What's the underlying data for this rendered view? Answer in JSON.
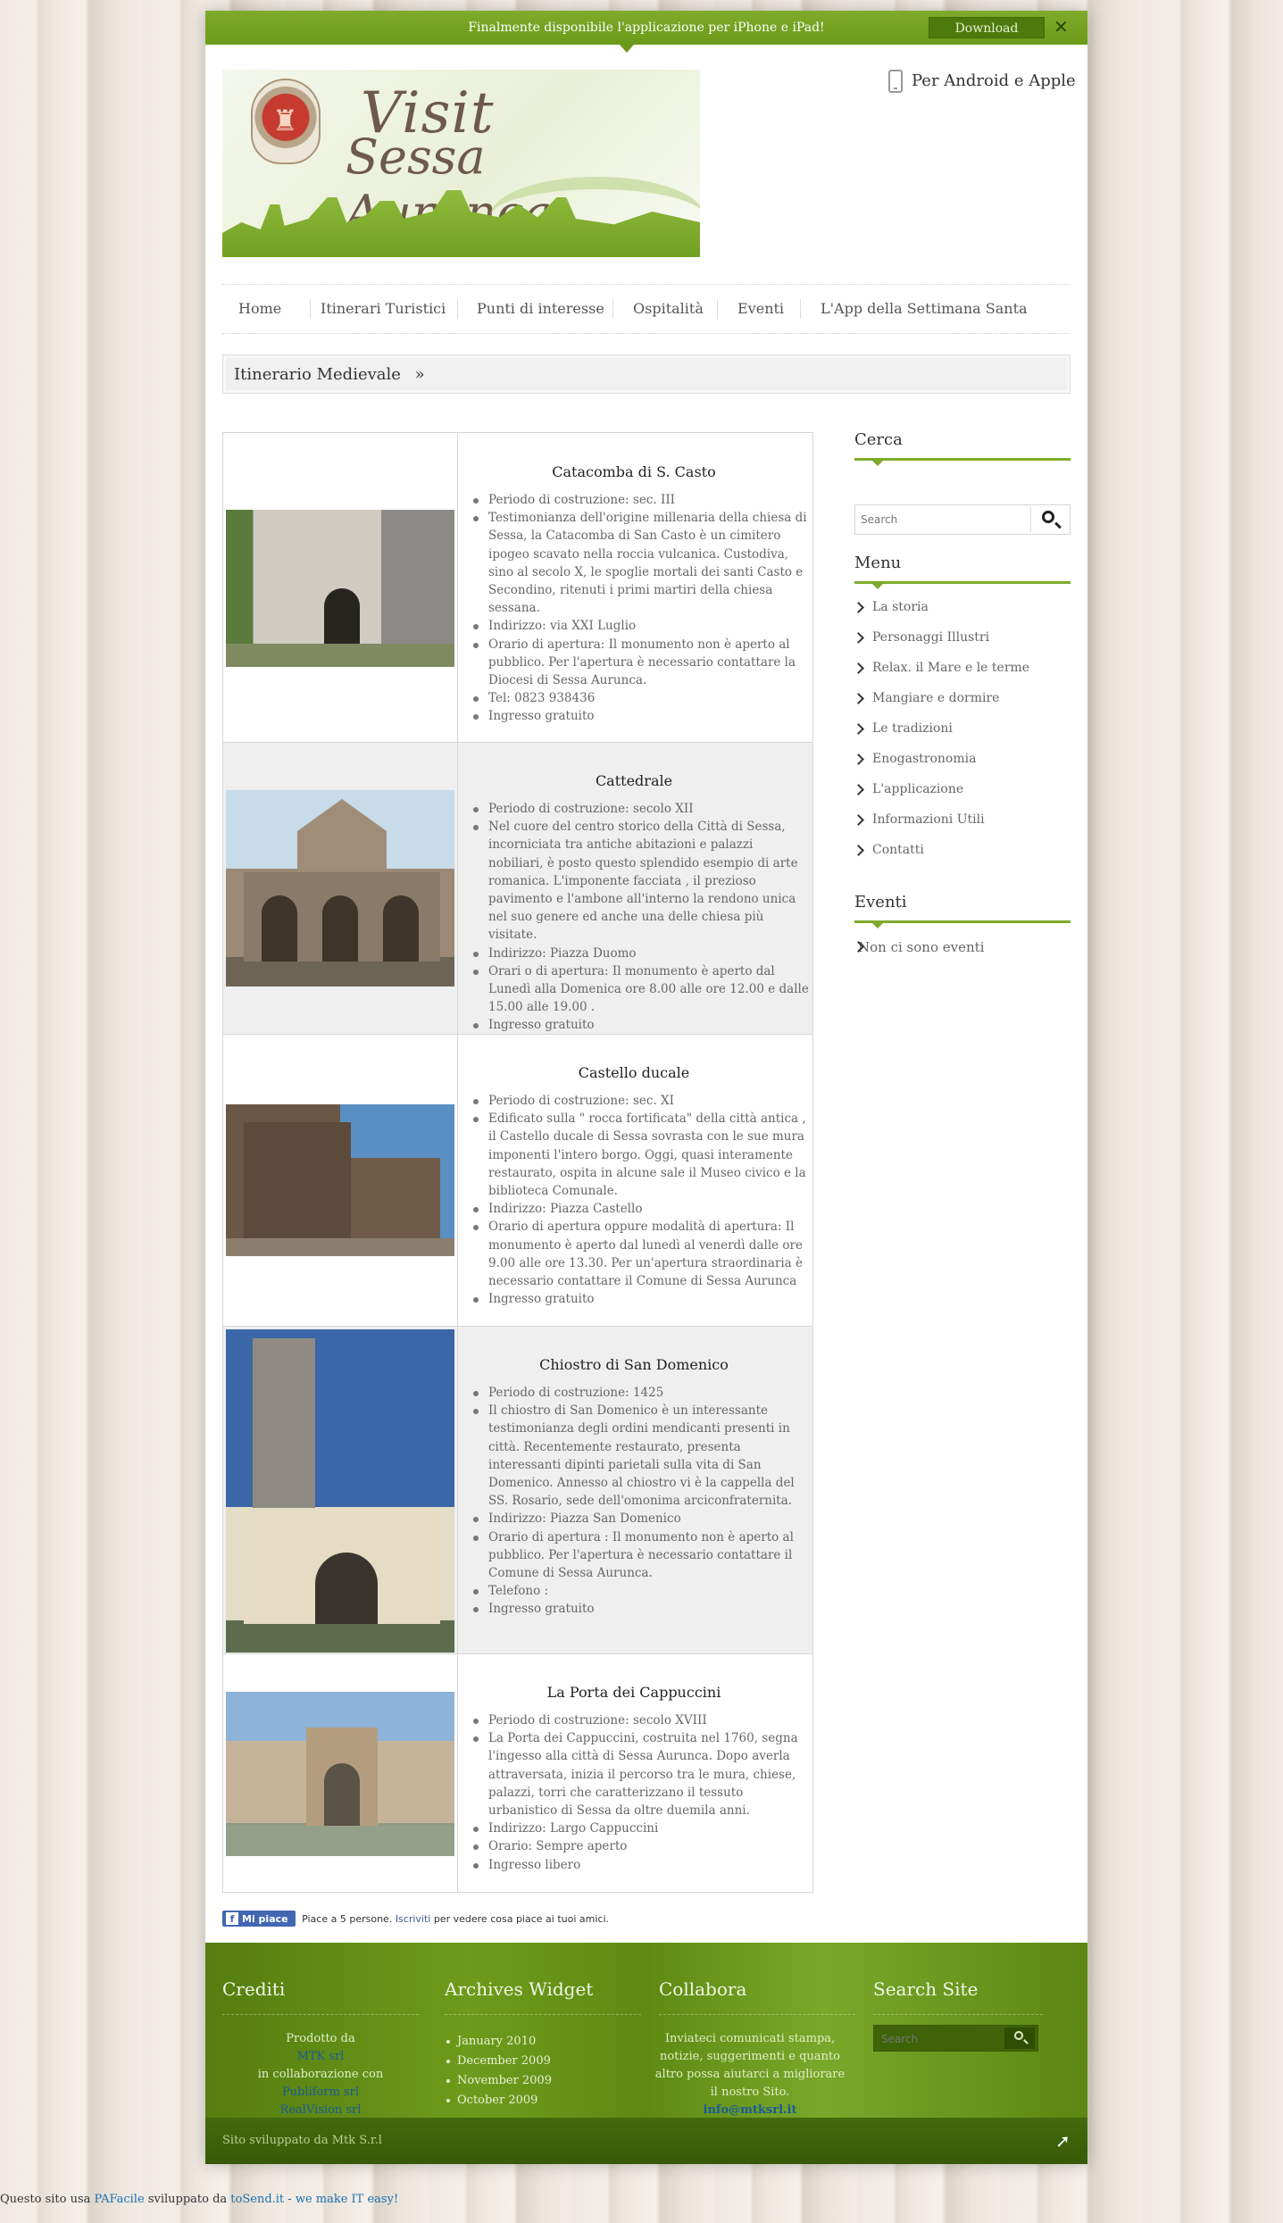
{
  "topbar": {
    "message": "Finalmente disponibile l'applicazione per iPhone e iPad!",
    "download_label": "Download",
    "close_icon": "close-icon",
    "accent_color": "#6a9a19"
  },
  "header": {
    "logo_line1": "Visit",
    "logo_line2": "Sessa Aurunca",
    "apps_label": "Per Android e Apple"
  },
  "nav": {
    "items": [
      "Home",
      "Itinerari Turistici",
      "Punti di interesse",
      "Ospitalità",
      "Eventi",
      "L'App della Settimana Santa"
    ]
  },
  "breadcrumb": {
    "label": "Itinerario Medievale",
    "separator": "»"
  },
  "places": [
    {
      "title": "Catacomba di S. Casto",
      "items": [
        "Periodo di costruzione: sec. III",
        "Testimonianza dell'origine millenaria della chiesa di Sessa, la Catacomba di San Casto è un cimitero ipogeo scavato nella roccia vulcanica. Custodiva, sino al secolo X, le spoglie mortali dei santi Casto e Secondino, ritenuti i primi martiri della chiesa sessana.",
        "Indirizzo: via XXI Luglio",
        "Orario di apertura: Il monumento non è aperto al pubblico. Per l'apertura è necessario contattare la Diocesi di Sessa Aurunca.",
        "Tel: 0823 938436",
        "Ingresso gratuito"
      ]
    },
    {
      "title": "Cattedrale",
      "items": [
        "Periodo di costruzione: secolo XII",
        "Nel cuore del centro storico della Città di Sessa, incorniciata tra antiche abitazioni e palazzi nobiliari, è posto questo splendido esempio di arte romanica. L'imponente facciata , il prezioso pavimento e l'ambone all'interno la rendono unica nel suo genere ed anche una delle chiesa più visitate.",
        "Indirizzo: Piazza Duomo",
        "Orari o di apertura: Il monumento è aperto dal Lunedì alla Domenica ore 8.00 alle ore 12.00 e dalle 15.00 alle 19.00 .",
        "Ingresso gratuito"
      ]
    },
    {
      "title": "Castello ducale",
      "items": [
        "Periodo di costruzione: sec. XI",
        "Edificato sulla \" rocca fortificata\" della città antica , il Castello ducale di Sessa sovrasta con le sue mura imponenti l'intero borgo. Oggi, quasi interamente restaurato, ospita in alcune sale il Museo civico e la biblioteca Comunale.",
        "Indirizzo: Piazza Castello",
        "Orario di apertura oppure modalità di apertura: Il monumento è aperto dal lunedì al venerdì dalle ore 9.00 alle ore 13.30. Per un'apertura straordinaria è necessario contattare il Comune di Sessa Aurunca",
        "Ingresso gratuito"
      ]
    },
    {
      "title": "Chiostro di San Domenico",
      "items": [
        "Periodo di costruzione: 1425",
        "Il chiostro di San Domenico è un interessante testimonianza degli ordini mendicanti presenti in città. Recentemente restaurato, presenta interessanti dipinti parietali sulla vita di San Domenico. Annesso al chiostro vi è la cappella del SS. Rosario, sede dell'omonima arciconfraternita.",
        "Indirizzo: Piazza San Domenico",
        "Orario di apertura : Il monumento non è aperto al pubblico. Per l'apertura è necessario contattare il Comune di Sessa Aurunca.",
        "Telefono :",
        "Ingresso gratuito"
      ]
    },
    {
      "title": "La Porta dei Cappuccini",
      "items": [
        "Periodo di costruzione: secolo XVIII",
        "La Porta dei Cappuccini, costruita nel 1760, segna l'ingesso alla città di Sessa Aurunca. Dopo averla attraversata, inizia il percorso tra le mura, chiese, palazzi, torri che caratterizzano il tessuto urbanistico di Sessa da oltre duemila anni.",
        "Indirizzo: Largo Cappuccini",
        "Orario: Sempre aperto",
        "Ingresso libero"
      ]
    }
  ],
  "sidebar": {
    "search_title": "Cerca",
    "search_placeholder": "Search",
    "menu_title": "Menu",
    "menu_items": [
      "La storia",
      "Personaggi Illustri",
      "Relax. il Mare e le terme",
      "Mangiare e dormire",
      "Le tradizioni",
      "Enogastronomia",
      "L'applicazione",
      "Informazioni Utili",
      "Contatti"
    ],
    "events_title": "Eventi",
    "events_empty": "Non ci sono eventi"
  },
  "facebook": {
    "like_label": "Mi piace",
    "text_before": "Piace a 5 persone.",
    "link": "Iscriviti",
    "text_after": "per vedere cosa piace ai tuoi amici."
  },
  "footer": {
    "credits_title": "Crediti",
    "credits_lines": [
      "Prodotto da",
      "MTK srl",
      "in collaborazione con",
      "Publiform srl",
      "RealVision srl"
    ],
    "archives_title": "Archives Widget",
    "archives": [
      "January 2010",
      "December 2009",
      "November 2009",
      "October 2009"
    ],
    "collabora_title": "Collabora",
    "collabora_text": [
      "Inviateci comunicati stampa,",
      "notizie, suggerimenti e quanto",
      "altro possa aiutarci a migliorare",
      "il nostro Sito."
    ],
    "collabora_email": "info@mtksrl.it",
    "search_title": "Search Site",
    "search_placeholder": "Search",
    "developed_by": "Sito sviluppato da Mtk S.r.l"
  },
  "credit": {
    "prefix": "Questo sito usa",
    "pafacile": "PAFacile",
    "middle": "sviluppato da",
    "tosend": "toSend.it - we make IT easy!"
  }
}
